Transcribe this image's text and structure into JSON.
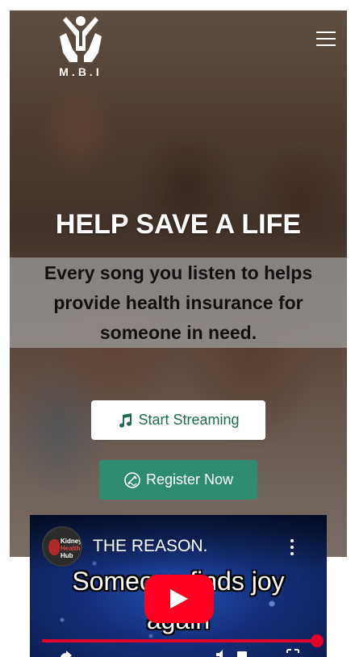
{
  "brand": {
    "logo_text": "M.B.I",
    "logo_icon": "person-hands-icon"
  },
  "nav": {
    "menu_icon": "hamburger-menu-icon"
  },
  "hero": {
    "headline": "HELP SAVE A LIFE",
    "subtitle": "Every song you listen to helps provide health insurance for someone in need.",
    "stream_button_label": "Start Streaming",
    "stream_button_icon": "music-note-icon",
    "register_button_label": "Register Now",
    "register_button_icon": "signature-icon"
  },
  "video": {
    "channel_name_line1": "Kidney",
    "channel_name_line2": "Health",
    "channel_name_line3": "Hub",
    "title": "THE REASON.",
    "caption_line1": "Someone finds joy",
    "caption_line2": "again",
    "play_icon": "youtube-play-icon",
    "more_icon": "more-vertical-icon",
    "progress": 1.0
  },
  "colors": {
    "primary_green": "#2f8b70",
    "stream_text_green": "#1e6b52",
    "youtube_red": "#ff0022"
  }
}
